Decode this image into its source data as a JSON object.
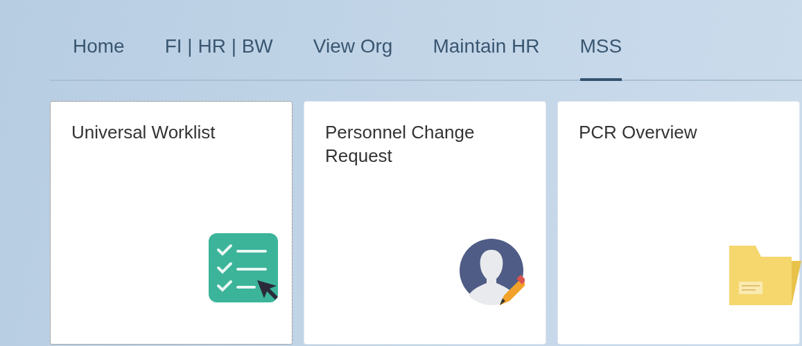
{
  "tabs": [
    {
      "label": "Home",
      "selected": false
    },
    {
      "label": "FI | HR | BW",
      "selected": false
    },
    {
      "label": "View Org",
      "selected": false
    },
    {
      "label": "Maintain HR",
      "selected": false
    },
    {
      "label": "MSS",
      "selected": true
    }
  ],
  "tiles": [
    {
      "title": "Universal Worklist",
      "kind": "checklist",
      "focused": true
    },
    {
      "title": "Personnel Change Request",
      "kind": "person",
      "focused": false
    },
    {
      "title": "PCR Overview",
      "kind": "folder",
      "focused": false
    }
  ]
}
